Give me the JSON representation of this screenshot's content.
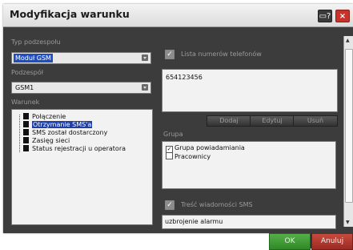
{
  "window": {
    "title": "Modyfikacja warunku",
    "help_icon": "help-window-icon",
    "close_label": "×"
  },
  "left": {
    "device_type_label": "Typ podzespołu",
    "device_type_value": "Moduł GSM",
    "subdevice_label": "Podzespół",
    "subdevice_value": "GSM1",
    "condition_label": "Warunek",
    "conditions": [
      "Połączenie",
      "Otrzymanie SMS'a",
      "SMS został dostarczony",
      "Zasięg sieci",
      "Status rejestracji u operatora"
    ]
  },
  "right": {
    "phones_checkbox_label": "Lista numerów telefonów",
    "phones": [
      "654123456"
    ],
    "add_label": "Dodaj",
    "edit_label": "Edytuj",
    "remove_label": "Usuń",
    "group_label": "Grupa",
    "groups": [
      {
        "label": "Grupa powiadamiania",
        "checked_mark": "✓"
      },
      {
        "label": "Pracownicy",
        "checked_mark": ""
      }
    ],
    "sms_checkbox_label": "Treść wiadomości SMS",
    "sms_text": "uzbrojenie alarmu"
  },
  "footer": {
    "ok_label": "OK",
    "cancel_label": "Anuluj"
  }
}
